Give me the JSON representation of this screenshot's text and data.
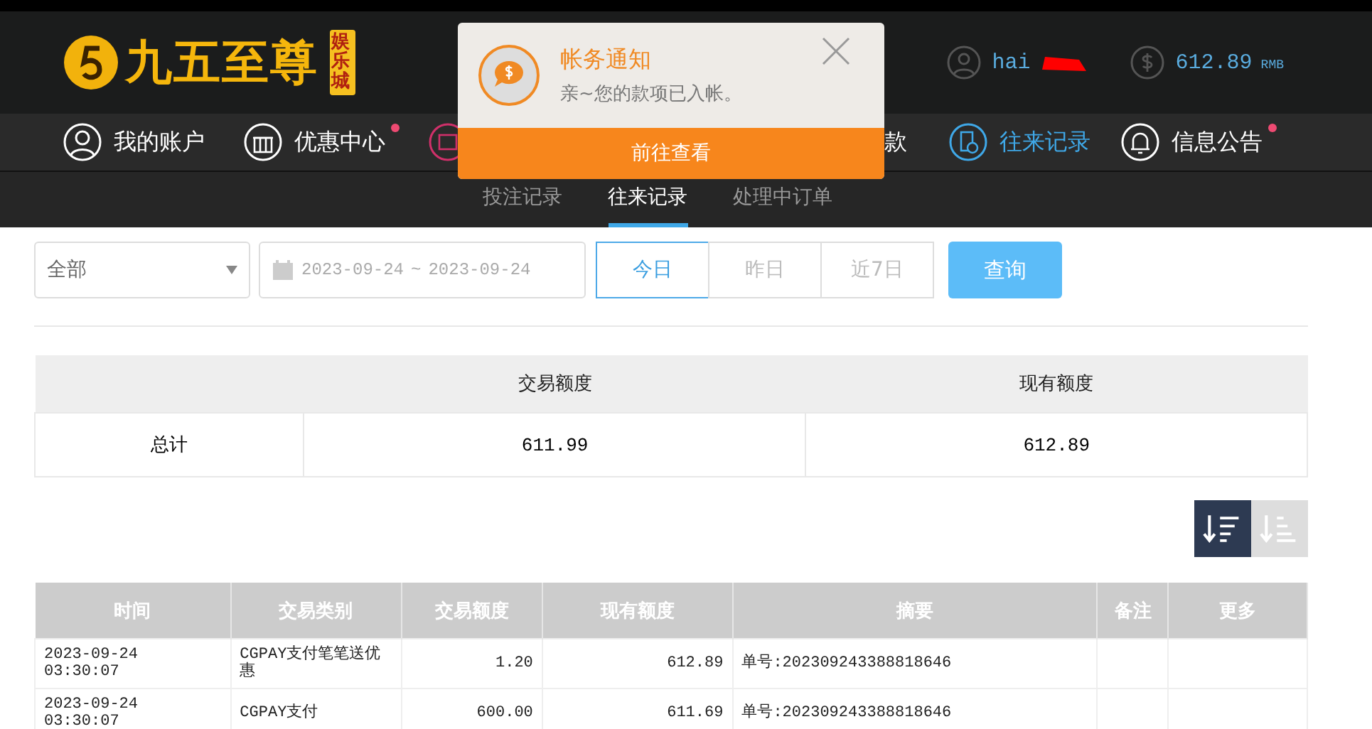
{
  "logo": {
    "name": "九五至尊",
    "badge": "娱乐城"
  },
  "user": {
    "name": "hai",
    "balance": "612.89",
    "currency": "RMB"
  },
  "nav": [
    {
      "label": "我的账户",
      "selected": false,
      "dot": false
    },
    {
      "label": "优惠中心",
      "selected": false,
      "dot": true
    },
    {
      "selected": false,
      "dot": false
    },
    {
      "label": "款",
      "selected": false,
      "dot": false
    },
    {
      "label": "往来记录",
      "selected": true,
      "dot": false
    },
    {
      "label": "信息公告",
      "selected": false,
      "dot": true
    }
  ],
  "subtabs": [
    {
      "label": "投注记录",
      "selected": false
    },
    {
      "label": "往来记录",
      "selected": true
    },
    {
      "label": "处理中订单",
      "selected": false
    }
  ],
  "notification": {
    "title": "帐务通知",
    "message": "亲~您的款项已入帐。",
    "button": "前往查看"
  },
  "filter": {
    "type": "全部",
    "date_from": "2023-09-24",
    "separator": "~",
    "date_to": "2023-09-24",
    "ranges": [
      {
        "label": "今日",
        "selected": true
      },
      {
        "label": "昨日",
        "selected": false
      },
      {
        "label": "近7日",
        "selected": false
      }
    ],
    "query": "查询"
  },
  "summary": {
    "columns": [
      "",
      "交易额度",
      "现有额度"
    ],
    "row": [
      "总计",
      "611.99",
      "612.89"
    ]
  },
  "sort": [
    {
      "selected": true
    },
    {
      "selected": false
    }
  ],
  "table": {
    "columns": [
      "时间",
      "交易类别",
      "交易额度",
      "现有额度",
      "摘要",
      "备注",
      "更多"
    ],
    "rows": [
      [
        "2023-09-24 03:30:07",
        "CGPAY支付笔笔送优惠",
        "1.20",
        "612.89",
        "单号:202309243388818646",
        "",
        ""
      ],
      [
        "2023-09-24 03:30:07",
        "CGPAY支付",
        "600.00",
        "611.69",
        "单号:202309243388818646",
        "",
        ""
      ]
    ]
  }
}
